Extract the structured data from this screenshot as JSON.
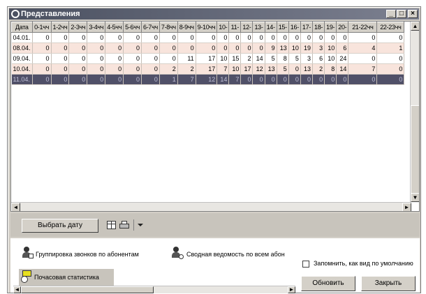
{
  "window": {
    "title": "Представления",
    "controls": [
      "_",
      "□",
      "×"
    ]
  },
  "grid": {
    "headers": [
      "Дата",
      "0-1чч",
      "1-2чч",
      "2-3чч",
      "3-4чч",
      "4-5чч",
      "5-6чч",
      "6-7чч",
      "7-8чч",
      "8-9чч",
      "9-10чч",
      "10-",
      "11-",
      "12-",
      "13-",
      "14-",
      "15-",
      "16-",
      "17-",
      "18-",
      "19-",
      "20-",
      "21-22чч",
      "22-23чч"
    ],
    "rows": [
      {
        "style": "white",
        "cells": [
          "04.01.",
          "0",
          "0",
          "0",
          "0",
          "0",
          "0",
          "0",
          "0",
          "0",
          "0",
          "0",
          "0",
          "0",
          "0",
          "0",
          "0",
          "0",
          "0",
          "0",
          "0",
          "0",
          "0",
          "0"
        ]
      },
      {
        "style": "pink",
        "cells": [
          "08.04.",
          "0",
          "0",
          "0",
          "0",
          "0",
          "0",
          "0",
          "0",
          "0",
          "0",
          "0",
          "0",
          "0",
          "0",
          "9",
          "13",
          "10",
          "19",
          "3",
          "10",
          "6",
          "4",
          "1"
        ]
      },
      {
        "style": "white",
        "cells": [
          "09.04.",
          "0",
          "0",
          "0",
          "0",
          "0",
          "0",
          "0",
          "0",
          "11",
          "17",
          "10",
          "15",
          "2",
          "14",
          "5",
          "8",
          "5",
          "3",
          "6",
          "10",
          "24",
          "0",
          "0"
        ]
      },
      {
        "style": "pink",
        "cells": [
          "10.04.",
          "0",
          "0",
          "0",
          "0",
          "0",
          "0",
          "0",
          "2",
          "2",
          "17",
          "7",
          "10",
          "17",
          "12",
          "13",
          "5",
          "0",
          "13",
          "2",
          "8",
          "14",
          "7",
          "0"
        ]
      },
      {
        "style": "sel",
        "cells": [
          "11.04.",
          "0",
          "0",
          "0",
          "0",
          "0",
          "0",
          "0",
          "1",
          "7",
          "12",
          "14",
          "7",
          "0",
          "0",
          "0",
          "0",
          "0",
          "0",
          "0",
          "0",
          "0",
          "0",
          "0"
        ]
      }
    ]
  },
  "toolbar": {
    "select_date_label": "Выбрать дату"
  },
  "nav": {
    "group_by_subscribers": "Группировка звонков по абонентам",
    "summary_all": "Сводная ведомость по всем абон",
    "hourly_stats": "Почасовая статистика",
    "remember_default": "Запомнить, как вид по умолчанию"
  },
  "buttons": {
    "refresh": "Обновить",
    "close": "Закрыть"
  }
}
